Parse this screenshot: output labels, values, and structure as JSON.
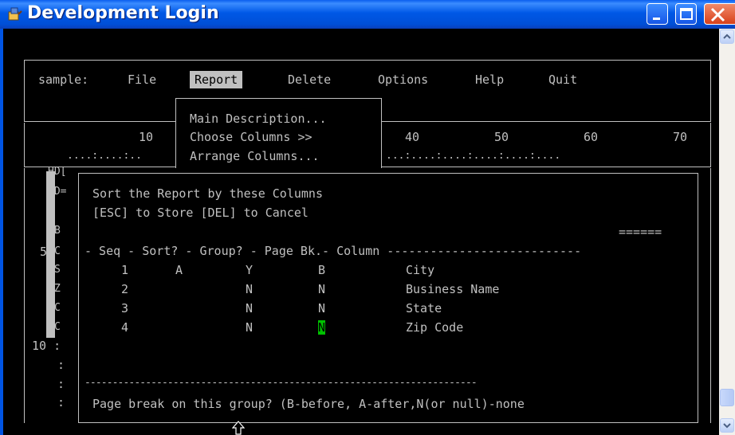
{
  "window": {
    "title": "Development Login",
    "icons": {
      "app": "terminal-icon",
      "minimize": "minimize-icon",
      "maximize": "maximize-icon",
      "close": "close-icon"
    }
  },
  "menubar": {
    "prefix": "sample:",
    "items": [
      "File",
      "Report",
      "Delete",
      "Options",
      "Help",
      "Quit"
    ],
    "active": "Report"
  },
  "submenu": {
    "items": [
      "Main Description...",
      "Choose Columns >>",
      "Arrange Columns..."
    ]
  },
  "ruler": {
    "numbers": [
      "10",
      "40",
      "50",
      "60",
      "70"
    ],
    "dots_left": "....:....:..",
    "dots_right": "...:....:....:....:....:...."
  },
  "left_margin": {
    "hd1": "HD[",
    "hd2": "HD=",
    "letters": [
      "B",
      "C",
      "S",
      "Z",
      "C",
      "C"
    ],
    "five": "5",
    "ten": "10 :",
    "colons": [
      ":",
      ":",
      ":"
    ]
  },
  "dialog": {
    "title": "Sort the Report by these Columns",
    "hint": "[ESC] to Store [DEL] to Cancel",
    "equals": "======",
    "header": "- Seq - Sort? - Group? - Page Bk.- Column ---------------------------",
    "rows": [
      {
        "seq": "1",
        "sort": "A",
        "group": "Y",
        "pagebk": "B",
        "column": "City"
      },
      {
        "seq": "2",
        "sort": "",
        "group": "N",
        "pagebk": "N",
        "column": "Business Name"
      },
      {
        "seq": "3",
        "sort": "",
        "group": "N",
        "pagebk": "N",
        "column": "State"
      },
      {
        "seq": "4",
        "sort": "",
        "group": "N",
        "pagebk": "N",
        "column": "Zip Code"
      }
    ],
    "separator": "-----------------------------------------------------------------------",
    "prompt": "Page break on this group? (B-before, A-after,N(or null)-none"
  },
  "colors": {
    "title_bar": "#0054E3",
    "terminal_bg": "#000000",
    "terminal_fg": "#C0C0C0",
    "cursor": "#00C000",
    "close_button": "#D8401A"
  }
}
